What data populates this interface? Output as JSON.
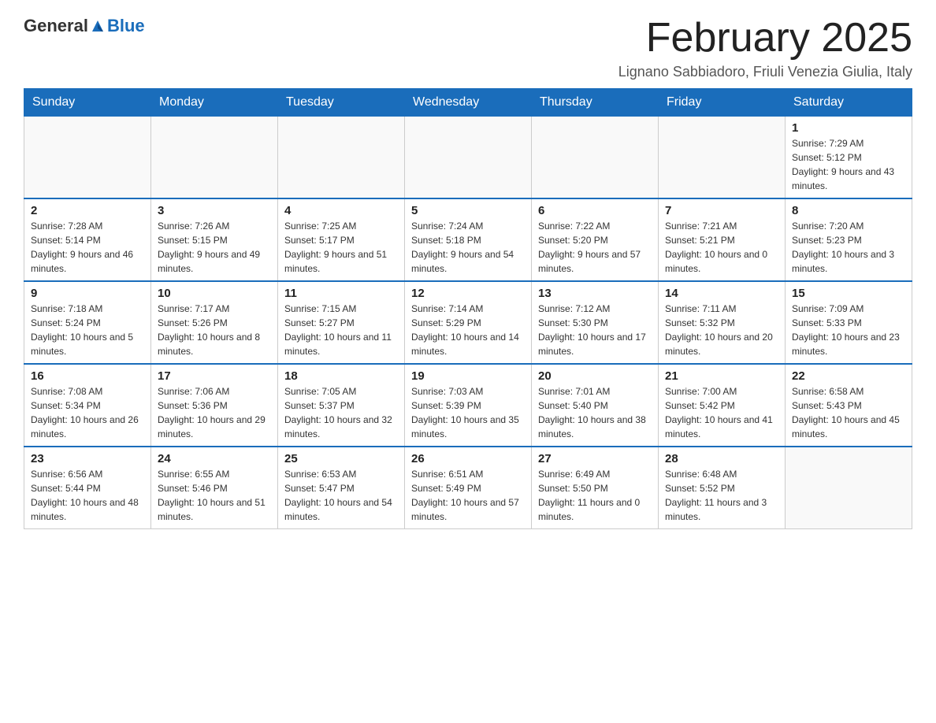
{
  "logo": {
    "general": "General",
    "blue": "Blue"
  },
  "title": "February 2025",
  "subtitle": "Lignano Sabbiadoro, Friuli Venezia Giulia, Italy",
  "days_of_week": [
    "Sunday",
    "Monday",
    "Tuesday",
    "Wednesday",
    "Thursday",
    "Friday",
    "Saturday"
  ],
  "weeks": [
    [
      {
        "day": "",
        "info": ""
      },
      {
        "day": "",
        "info": ""
      },
      {
        "day": "",
        "info": ""
      },
      {
        "day": "",
        "info": ""
      },
      {
        "day": "",
        "info": ""
      },
      {
        "day": "",
        "info": ""
      },
      {
        "day": "1",
        "info": "Sunrise: 7:29 AM\nSunset: 5:12 PM\nDaylight: 9 hours and 43 minutes."
      }
    ],
    [
      {
        "day": "2",
        "info": "Sunrise: 7:28 AM\nSunset: 5:14 PM\nDaylight: 9 hours and 46 minutes."
      },
      {
        "day": "3",
        "info": "Sunrise: 7:26 AM\nSunset: 5:15 PM\nDaylight: 9 hours and 49 minutes."
      },
      {
        "day": "4",
        "info": "Sunrise: 7:25 AM\nSunset: 5:17 PM\nDaylight: 9 hours and 51 minutes."
      },
      {
        "day": "5",
        "info": "Sunrise: 7:24 AM\nSunset: 5:18 PM\nDaylight: 9 hours and 54 minutes."
      },
      {
        "day": "6",
        "info": "Sunrise: 7:22 AM\nSunset: 5:20 PM\nDaylight: 9 hours and 57 minutes."
      },
      {
        "day": "7",
        "info": "Sunrise: 7:21 AM\nSunset: 5:21 PM\nDaylight: 10 hours and 0 minutes."
      },
      {
        "day": "8",
        "info": "Sunrise: 7:20 AM\nSunset: 5:23 PM\nDaylight: 10 hours and 3 minutes."
      }
    ],
    [
      {
        "day": "9",
        "info": "Sunrise: 7:18 AM\nSunset: 5:24 PM\nDaylight: 10 hours and 5 minutes."
      },
      {
        "day": "10",
        "info": "Sunrise: 7:17 AM\nSunset: 5:26 PM\nDaylight: 10 hours and 8 minutes."
      },
      {
        "day": "11",
        "info": "Sunrise: 7:15 AM\nSunset: 5:27 PM\nDaylight: 10 hours and 11 minutes."
      },
      {
        "day": "12",
        "info": "Sunrise: 7:14 AM\nSunset: 5:29 PM\nDaylight: 10 hours and 14 minutes."
      },
      {
        "day": "13",
        "info": "Sunrise: 7:12 AM\nSunset: 5:30 PM\nDaylight: 10 hours and 17 minutes."
      },
      {
        "day": "14",
        "info": "Sunrise: 7:11 AM\nSunset: 5:32 PM\nDaylight: 10 hours and 20 minutes."
      },
      {
        "day": "15",
        "info": "Sunrise: 7:09 AM\nSunset: 5:33 PM\nDaylight: 10 hours and 23 minutes."
      }
    ],
    [
      {
        "day": "16",
        "info": "Sunrise: 7:08 AM\nSunset: 5:34 PM\nDaylight: 10 hours and 26 minutes."
      },
      {
        "day": "17",
        "info": "Sunrise: 7:06 AM\nSunset: 5:36 PM\nDaylight: 10 hours and 29 minutes."
      },
      {
        "day": "18",
        "info": "Sunrise: 7:05 AM\nSunset: 5:37 PM\nDaylight: 10 hours and 32 minutes."
      },
      {
        "day": "19",
        "info": "Sunrise: 7:03 AM\nSunset: 5:39 PM\nDaylight: 10 hours and 35 minutes."
      },
      {
        "day": "20",
        "info": "Sunrise: 7:01 AM\nSunset: 5:40 PM\nDaylight: 10 hours and 38 minutes."
      },
      {
        "day": "21",
        "info": "Sunrise: 7:00 AM\nSunset: 5:42 PM\nDaylight: 10 hours and 41 minutes."
      },
      {
        "day": "22",
        "info": "Sunrise: 6:58 AM\nSunset: 5:43 PM\nDaylight: 10 hours and 45 minutes."
      }
    ],
    [
      {
        "day": "23",
        "info": "Sunrise: 6:56 AM\nSunset: 5:44 PM\nDaylight: 10 hours and 48 minutes."
      },
      {
        "day": "24",
        "info": "Sunrise: 6:55 AM\nSunset: 5:46 PM\nDaylight: 10 hours and 51 minutes."
      },
      {
        "day": "25",
        "info": "Sunrise: 6:53 AM\nSunset: 5:47 PM\nDaylight: 10 hours and 54 minutes."
      },
      {
        "day": "26",
        "info": "Sunrise: 6:51 AM\nSunset: 5:49 PM\nDaylight: 10 hours and 57 minutes."
      },
      {
        "day": "27",
        "info": "Sunrise: 6:49 AM\nSunset: 5:50 PM\nDaylight: 11 hours and 0 minutes."
      },
      {
        "day": "28",
        "info": "Sunrise: 6:48 AM\nSunset: 5:52 PM\nDaylight: 11 hours and 3 minutes."
      },
      {
        "day": "",
        "info": ""
      }
    ]
  ]
}
